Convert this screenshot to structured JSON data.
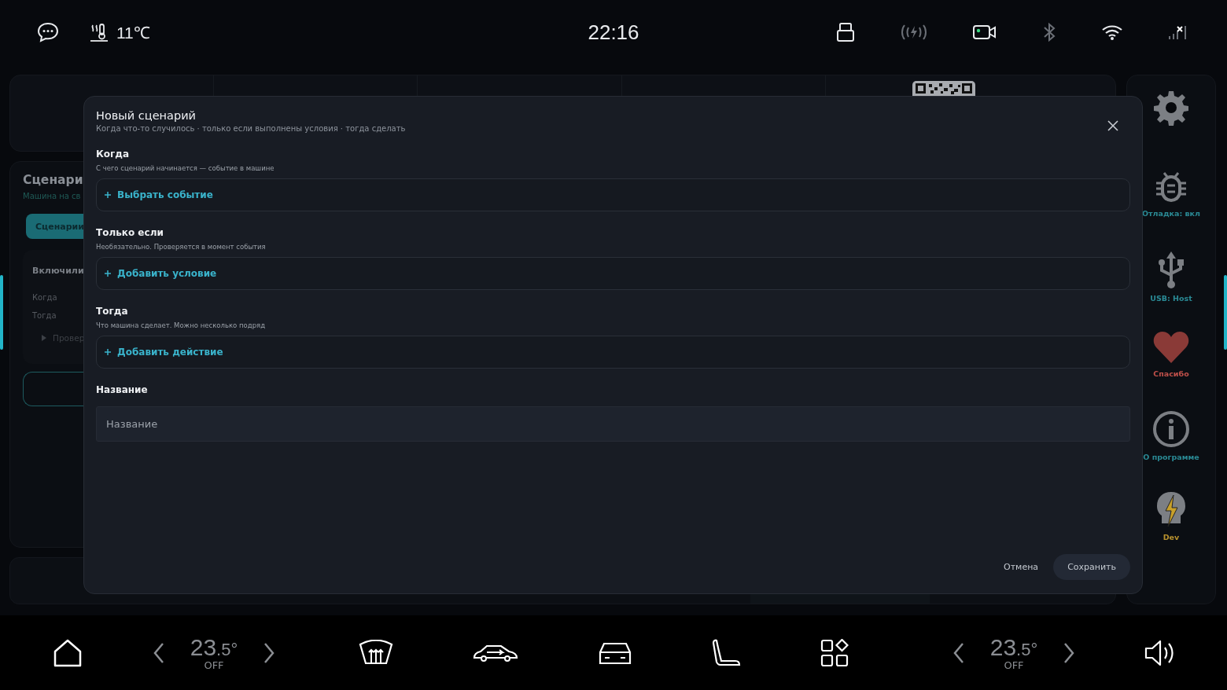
{
  "status_bar": {
    "outside_temp": "11℃",
    "time": "22:16"
  },
  "background": {
    "panel_title": "Сценари",
    "panel_subtitle": "Машина на св",
    "tab": {
      "label": "Сценарии",
      "selected": true
    },
    "card_title": "Включили",
    "rows": [
      {
        "label": "Когда"
      },
      {
        "label": "Тогда"
      }
    ],
    "expander": "Провер"
  },
  "dialog": {
    "title": "Новый сценарий",
    "subtitle": "Когда что-то случилось · только если выполнены условия · тогда сделать",
    "sections": [
      {
        "kind": "picker",
        "title": "Когда",
        "hint": "С чего сценарий начинается — событие в машине",
        "action": "Выбрать событие"
      },
      {
        "kind": "picker",
        "title": "Только если",
        "hint": "Необязательно. Проверяется в момент события",
        "action": "Добавить условие"
      },
      {
        "kind": "picker",
        "title": "Тогда",
        "hint": "Что машина сделает. Можно несколько подряд",
        "action": "Добавить действие"
      },
      {
        "kind": "field",
        "title": "Название",
        "placeholder": "Название"
      }
    ],
    "buttons": [
      {
        "label": "Отмена",
        "kind": "text"
      },
      {
        "label": "Сохранить",
        "kind": "filled"
      }
    ]
  },
  "sidebar": {
    "items": [
      {
        "label": "Отладка: вкл",
        "color": "#2a8a95"
      },
      {
        "label": "USB: Host",
        "color": "#2a8a95"
      },
      {
        "label": "Спасибо",
        "color": "#c0504a"
      },
      {
        "label": "О программе",
        "color": "#2a8a95"
      },
      {
        "label": "Dev",
        "color": "#b8912e"
      }
    ]
  },
  "dock": {
    "climate": [
      {
        "whole": "23",
        "fraction": ".5°",
        "status": "OFF"
      },
      {
        "whole": "23",
        "fraction": ".5°",
        "status": "OFF"
      }
    ]
  }
}
